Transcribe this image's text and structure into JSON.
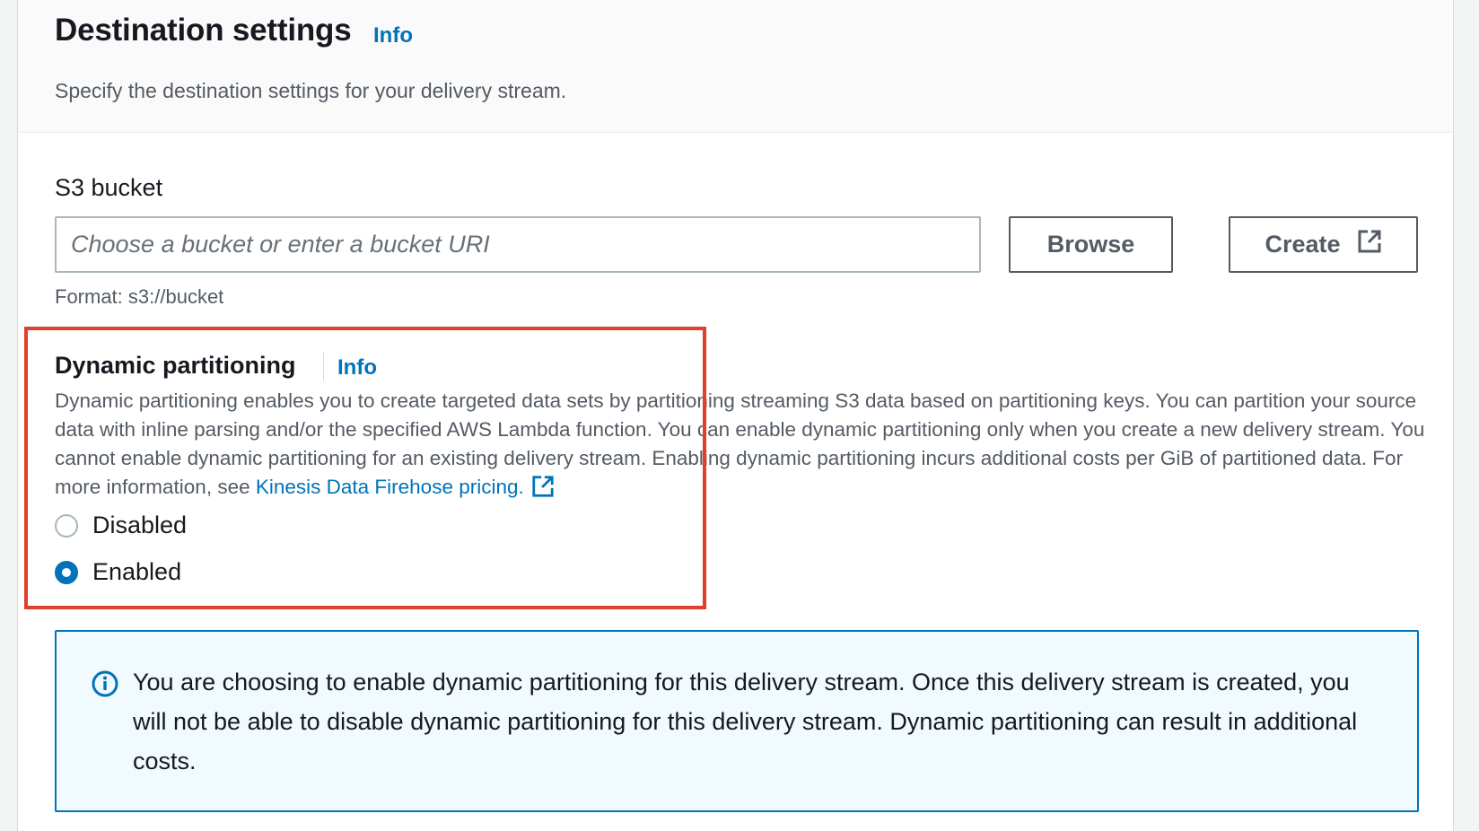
{
  "header": {
    "title": "Destination settings",
    "info_link": "Info",
    "description": "Specify the destination settings for your delivery stream."
  },
  "s3_bucket": {
    "label": "S3 bucket",
    "placeholder": "Choose a bucket or enter a bucket URI",
    "value": "",
    "browse_button": "Browse",
    "create_button": "Create",
    "format_hint": "Format: s3://bucket"
  },
  "dynamic_partitioning": {
    "title": "Dynamic partitioning",
    "info_link": "Info",
    "description": "Dynamic partitioning enables you to create targeted data sets by partitioning streaming S3 data based on partitioning keys. You can partition your source data with inline parsing and/or the specified AWS Lambda function. You can enable dynamic partitioning only when you create a new delivery stream. You cannot enable dynamic partitioning for an existing delivery stream. Enabling dynamic partitioning incurs additional costs per GiB of partitioned data. For more information, see ",
    "pricing_link": "Kinesis Data Firehose pricing.",
    "options": [
      {
        "label": "Disabled",
        "selected": false
      },
      {
        "label": "Enabled",
        "selected": true
      }
    ]
  },
  "alert": {
    "icon": "info-icon",
    "text": "You are choosing to enable dynamic partitioning for this delivery stream. Once this delivery stream is created, you will not be able to disable dynamic partitioning for this delivery stream. Dynamic partitioning can result in additional costs."
  },
  "colors": {
    "link": "#0073bb",
    "highlight": "#e0402a",
    "alert_background": "#f1faff"
  }
}
